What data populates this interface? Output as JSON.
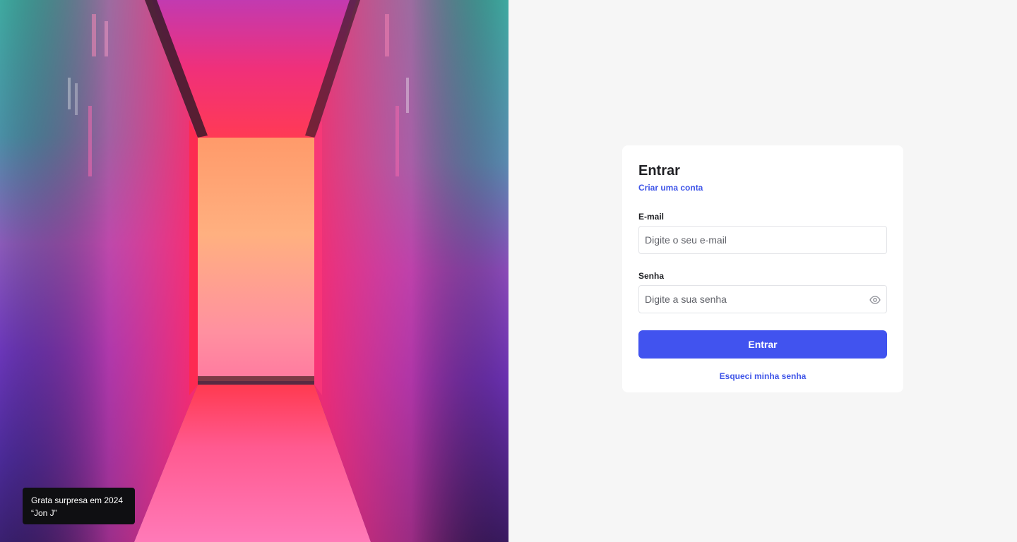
{
  "hero": {
    "image_icon": "neon-corridor-photo",
    "caption": {
      "line1": "Grata surpresa em 2024",
      "line2": "“Jon J”"
    }
  },
  "login": {
    "title": "Entrar",
    "create_account_link": "Criar uma conta",
    "email": {
      "label": "E-mail",
      "placeholder": "Digite o seu e-mail",
      "value": ""
    },
    "password": {
      "label": "Senha",
      "placeholder": "Digite a sua senha",
      "value": "",
      "toggle_icon": "eye-icon"
    },
    "submit_label": "Entrar",
    "forgot_link": "Esqueci minha senha"
  },
  "colors": {
    "accent": "#4153ef",
    "link": "#3f55e8",
    "background": "#f6f6f6",
    "caption_bg": "#0f0f12"
  }
}
